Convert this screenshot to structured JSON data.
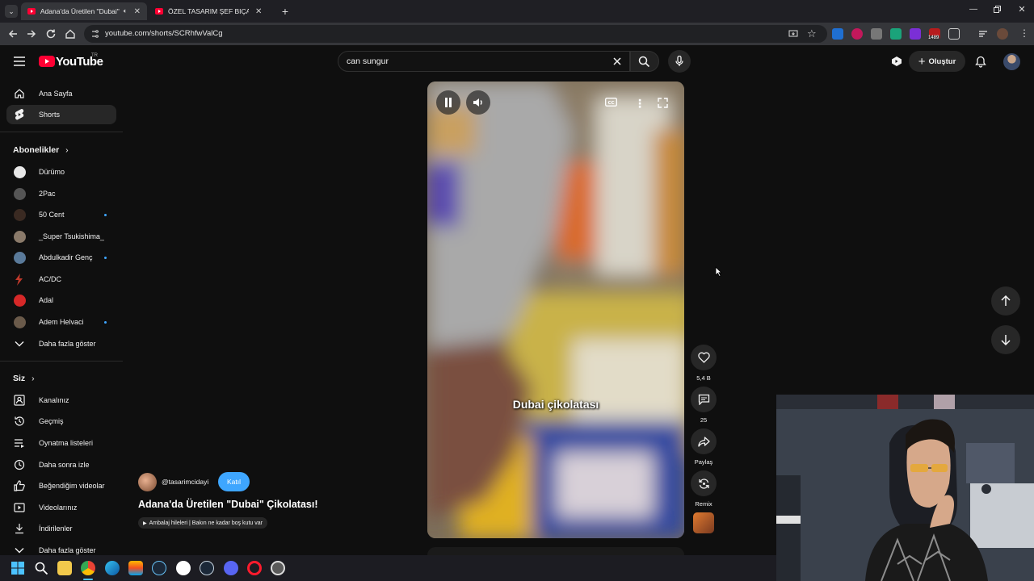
{
  "browser": {
    "tabs": [
      {
        "title": "Adana'da Üretilen \"Dubai\" Ç",
        "active": true
      },
      {
        "title": "ÖZEL TASARIM ŞEF BIÇAĞINI İ",
        "active": false
      }
    ],
    "url": "youtube.com/shorts/SCRhfwValCg",
    "extension_badge": "1489"
  },
  "header": {
    "logo": "YouTube",
    "region": "TR",
    "search_value": "can sungur",
    "create_label": "Oluştur"
  },
  "sidebar": {
    "main": [
      {
        "label": "Ana Sayfa",
        "icon": "home-icon"
      },
      {
        "label": "Shorts",
        "icon": "shorts-icon",
        "selected": true
      }
    ],
    "subscriptions_title": "Abonelikler",
    "subscriptions": [
      {
        "label": "Dürümo",
        "avatar_color": "#e8e8e8",
        "new": false
      },
      {
        "label": "2Pac",
        "avatar_color": "#555555",
        "new": false
      },
      {
        "label": "50 Cent",
        "avatar_color": "#3a2a22",
        "new": true
      },
      {
        "label": "_Super Tsukishima_",
        "avatar_color": "#8a7a6a",
        "new": false
      },
      {
        "label": "Abdulkadir Genç",
        "avatar_color": "#5a7a9a",
        "new": true
      },
      {
        "label": "AC/DC",
        "avatar_color": "#c0392b",
        "new": false
      },
      {
        "label": "Adal",
        "avatar_color": "#d62828",
        "new": false
      },
      {
        "label": "Adem Helvaci",
        "avatar_color": "#6a5a4a",
        "new": true
      }
    ],
    "show_more": "Daha fazla göster",
    "you_title": "Siz",
    "you": [
      {
        "label": "Kanalınız",
        "icon": "channel-icon"
      },
      {
        "label": "Geçmiş",
        "icon": "history-icon"
      },
      {
        "label": "Oynatma listeleri",
        "icon": "playlists-icon"
      },
      {
        "label": "Daha sonra izle",
        "icon": "watch-later-icon"
      },
      {
        "label": "Beğendiğim videolar",
        "icon": "like-icon"
      },
      {
        "label": "Videolarınız",
        "icon": "your-videos-icon"
      },
      {
        "label": "İndirilenler",
        "icon": "download-icon"
      }
    ],
    "you_show_more": "Daha fazla göster"
  },
  "short": {
    "subtitle": "Dubai çikolatası",
    "channel": "@tasarimcidayi",
    "join_label": "Katıl",
    "title": "Adana'da Üretilen \"Dubai\" Çikolatası!",
    "playlist": "Ambalaj hileleri | Bakın ne kadar boş kutu var",
    "actions": {
      "likes": "5,4 B",
      "comments": "25",
      "share": "Paylaş",
      "remix": "Remix"
    }
  }
}
